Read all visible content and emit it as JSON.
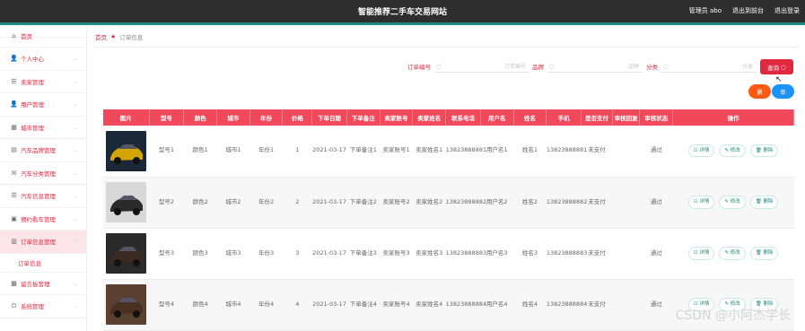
{
  "header": {
    "title": "智能推荐二手车交易网站",
    "user_label": "管理员 abo",
    "exit_backend": "退出到前台",
    "logout": "退出登录"
  },
  "sidebar": {
    "items": [
      {
        "label": "首页",
        "icon": "home-icon"
      },
      {
        "label": "个人中心",
        "icon": "user-icon"
      },
      {
        "label": "卖家管理",
        "icon": "list-icon"
      },
      {
        "label": "用户管理",
        "icon": "user-icon"
      },
      {
        "label": "城市管理",
        "icon": "building-icon"
      },
      {
        "label": "汽车品牌管理",
        "icon": "car-icon"
      },
      {
        "label": "汽车分类管理",
        "icon": "mail-icon"
      },
      {
        "label": "汽车信息管理",
        "icon": "list-icon"
      },
      {
        "label": "预约看车管理",
        "icon": "calendar-icon"
      },
      {
        "label": "订单信息管理",
        "icon": "document-icon"
      }
    ],
    "sub_item": "订单信息",
    "items2": [
      {
        "label": "留言板管理",
        "icon": "message-icon"
      },
      {
        "label": "系统管理",
        "icon": "power-icon"
      }
    ]
  },
  "breadcrumb": {
    "home": "首页",
    "current": "订单信息"
  },
  "search": {
    "order_label": "订单编号",
    "order_placeholder": "订单编号",
    "brand_label": "品牌",
    "brand_placeholder": "品牌",
    "category_label": "分类",
    "category_placeholder": "分类",
    "search_button": "查询"
  },
  "actions": {
    "orange_button": "删",
    "blue_button": "审"
  },
  "table": {
    "headers": [
      "图片",
      "型号",
      "颜色",
      "城市",
      "年份",
      "价格",
      "下单日期",
      "下单备注",
      "卖家账号",
      "卖家姓名",
      "联系电话",
      "用户名",
      "姓名",
      "手机",
      "是否支付",
      "审核回复",
      "审核状态",
      "操作"
    ],
    "rows": [
      {
        "model": "型号1",
        "color": "颜色1",
        "city": "城市1",
        "year": "年份1",
        "price": "1",
        "date": "2021-03-17",
        "note": "下单备注1",
        "seller_acc": "卖家账号1",
        "seller_name": "卖家姓名1",
        "phone": "13823888881",
        "username": "用户名1",
        "name": "姓名1",
        "mobile": "13823888881",
        "paid": "未支付",
        "reply": "",
        "status": "通过"
      },
      {
        "model": "型号2",
        "color": "颜色2",
        "city": "城市2",
        "year": "年份2",
        "price": "2",
        "date": "2021-03-17",
        "note": "下单备注2",
        "seller_acc": "卖家账号2",
        "seller_name": "卖家姓名2",
        "phone": "13823888882",
        "username": "用户名2",
        "name": "姓名2",
        "mobile": "13823888882",
        "paid": "未支付",
        "reply": "",
        "status": "通过"
      },
      {
        "model": "型号3",
        "color": "颜色3",
        "city": "城市3",
        "year": "年份3",
        "price": "3",
        "date": "2021-03-17",
        "note": "下单备注3",
        "seller_acc": "卖家账号3",
        "seller_name": "卖家姓名3",
        "phone": "13823888883",
        "username": "用户名3",
        "name": "姓名3",
        "mobile": "13823888883",
        "paid": "未支付",
        "reply": "",
        "status": "通过"
      },
      {
        "model": "型号4",
        "color": "颜色4",
        "city": "城市4",
        "year": "年份4",
        "price": "4",
        "date": "2021-03-17",
        "note": "下单备注4",
        "seller_acc": "卖家账号4",
        "seller_name": "卖家姓名4",
        "phone": "13823888884",
        "username": "用户名4",
        "name": "姓名4",
        "mobile": "13823888884",
        "paid": "未支付",
        "reply": "",
        "status": "通过"
      }
    ],
    "op_detail": "详情",
    "op_edit": "修改",
    "op_delete": "删除"
  },
  "watermark": "CSDN @小阿杰学长",
  "colors": {
    "accent": "#e0283f",
    "header_bg": "#2e2e2e",
    "teal": "#1e8a80",
    "table_head": "#f2485b"
  }
}
